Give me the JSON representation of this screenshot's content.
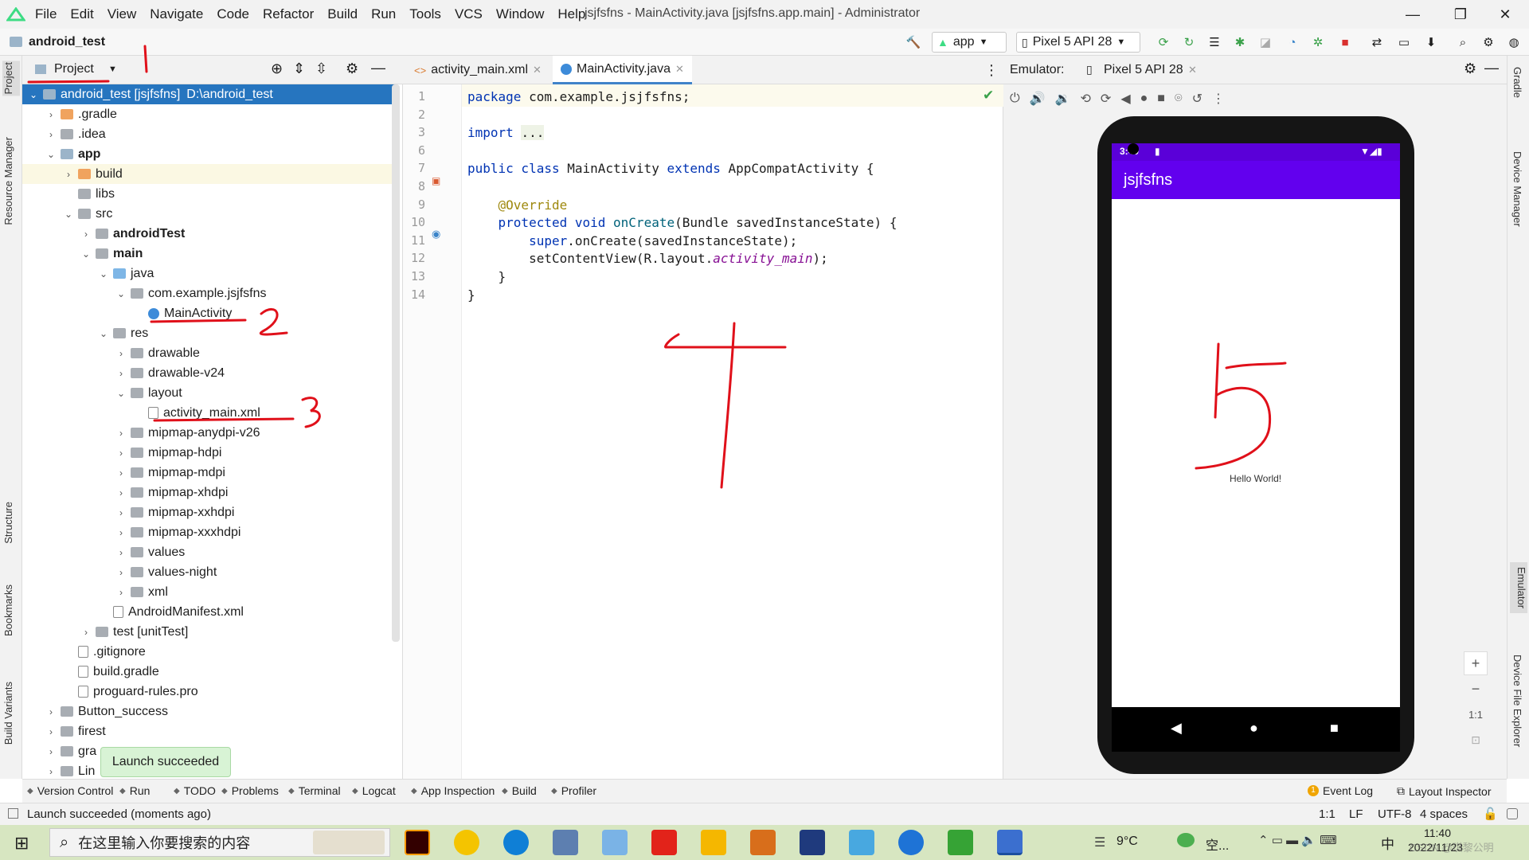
{
  "app": {
    "menus": [
      "File",
      "Edit",
      "View",
      "Navigate",
      "Code",
      "Refactor",
      "Build",
      "Run",
      "Tools",
      "VCS",
      "Window",
      "Help"
    ],
    "window_title": "jsjfsfns - MainActivity.java [jsjfsfns.app.main] - Administrator",
    "project_name": "android_test",
    "colors": {
      "accent": "#2675bf",
      "android_green": "#3ddc84",
      "app_bar": "#6200ee",
      "annotation_red": "#e0101a"
    }
  },
  "toolbar": {
    "run_config": "app",
    "device": "Pixel 5 API 28"
  },
  "left_stripe": [
    "Project",
    "Resource Manager",
    "Structure",
    "Bookmarks",
    "Build Variants"
  ],
  "right_stripe": [
    "Gradle",
    "Device Manager",
    "Emulator",
    "Device File Explorer"
  ],
  "project_panel": {
    "view_mode": "Project",
    "tree": [
      {
        "label": "android_test [jsjfsfns]",
        "suffix": "D:\\android_test",
        "depth": 0,
        "icon": "fold-m",
        "open": true,
        "selected": true
      },
      {
        "label": ".gradle",
        "depth": 1,
        "icon": "fold-o",
        "open": false
      },
      {
        "label": ".idea",
        "depth": 1,
        "icon": "fold",
        "open": false
      },
      {
        "label": "app",
        "depth": 1,
        "icon": "fold-m",
        "open": true,
        "bold": true
      },
      {
        "label": "build",
        "depth": 2,
        "icon": "fold-o",
        "open": false,
        "highlight": true
      },
      {
        "label": "libs",
        "depth": 2,
        "icon": "fold",
        "leaf": true
      },
      {
        "label": "src",
        "depth": 2,
        "icon": "fold",
        "open": true
      },
      {
        "label": "androidTest",
        "depth": 3,
        "icon": "fold",
        "open": false,
        "bold": true
      },
      {
        "label": "main",
        "depth": 3,
        "icon": "fold",
        "open": true,
        "bold": true
      },
      {
        "label": "java",
        "depth": 4,
        "icon": "fold-b",
        "open": true
      },
      {
        "label": "com.example.jsjfsfns",
        "depth": 5,
        "icon": "fold",
        "open": true
      },
      {
        "label": "MainActivity",
        "depth": 6,
        "icon": "cls",
        "leaf": true
      },
      {
        "label": "res",
        "depth": 4,
        "icon": "fold",
        "open": true
      },
      {
        "label": "drawable",
        "depth": 5,
        "icon": "fold",
        "open": false
      },
      {
        "label": "drawable-v24",
        "depth": 5,
        "icon": "fold",
        "open": false
      },
      {
        "label": "layout",
        "depth": 5,
        "icon": "fold",
        "open": true
      },
      {
        "label": "activity_main.xml",
        "depth": 6,
        "icon": "file",
        "leaf": true
      },
      {
        "label": "mipmap-anydpi-v26",
        "depth": 5,
        "icon": "fold",
        "open": false
      },
      {
        "label": "mipmap-hdpi",
        "depth": 5,
        "icon": "fold",
        "open": false
      },
      {
        "label": "mipmap-mdpi",
        "depth": 5,
        "icon": "fold",
        "open": false
      },
      {
        "label": "mipmap-xhdpi",
        "depth": 5,
        "icon": "fold",
        "open": false
      },
      {
        "label": "mipmap-xxhdpi",
        "depth": 5,
        "icon": "fold",
        "open": false
      },
      {
        "label": "mipmap-xxxhdpi",
        "depth": 5,
        "icon": "fold",
        "open": false
      },
      {
        "label": "values",
        "depth": 5,
        "icon": "fold",
        "open": false
      },
      {
        "label": "values-night",
        "depth": 5,
        "icon": "fold",
        "open": false
      },
      {
        "label": "xml",
        "depth": 5,
        "icon": "fold",
        "open": false
      },
      {
        "label": "AndroidManifest.xml",
        "depth": 4,
        "icon": "file",
        "leaf": true
      },
      {
        "label": "test [unitTest]",
        "depth": 3,
        "icon": "fold",
        "open": false
      },
      {
        "label": ".gitignore",
        "depth": 2,
        "icon": "file",
        "leaf": true
      },
      {
        "label": "build.gradle",
        "depth": 2,
        "icon": "file",
        "leaf": true
      },
      {
        "label": "proguard-rules.pro",
        "depth": 2,
        "icon": "file",
        "leaf": true
      },
      {
        "label": "Button_success",
        "depth": 1,
        "icon": "fold",
        "open": false
      },
      {
        "label": "firest",
        "depth": 1,
        "icon": "fold",
        "open": false
      },
      {
        "label": "gra",
        "depth": 1,
        "icon": "fold",
        "open": false
      },
      {
        "label": "Lin",
        "depth": 1,
        "icon": "fold",
        "open": false
      }
    ]
  },
  "editor": {
    "tabs": [
      {
        "label": "activity_main.xml",
        "active": false
      },
      {
        "label": "MainActivity.java",
        "active": true
      }
    ],
    "lines": [
      {
        "n": "1",
        "html": "<span class='kw'>package</span> com.example.jsjfsfns;"
      },
      {
        "n": "2",
        "html": ""
      },
      {
        "n": "3",
        "html": "<span class='kw'>import</span> <span style='background:#eef3e6'>...</span>"
      },
      {
        "n": "6",
        "html": ""
      },
      {
        "n": "7",
        "html": "<span class='kw'>public class</span> MainActivity <span class='kw'>extends</span> AppCompatActivity {"
      },
      {
        "n": "8",
        "html": ""
      },
      {
        "n": "9",
        "html": "    <span class='ann'>@Override</span>"
      },
      {
        "n": "10",
        "html": "    <span class='kw'>protected void</span> <span class='fn'>onCreate</span>(Bundle savedInstanceState) {"
      },
      {
        "n": "11",
        "html": "        <span class='kw'>super</span>.onCreate(savedInstanceState);"
      },
      {
        "n": "12",
        "html": "        setContentView(R.layout.<span class='it'>activity_main</span>);"
      },
      {
        "n": "13",
        "html": "    }"
      },
      {
        "n": "14",
        "html": "}"
      }
    ]
  },
  "emulator": {
    "label": "Emulator:",
    "tab": "Pixel 5 API 28",
    "clock": "3:40",
    "app_title": "jsjfsfns",
    "screen_text": "Hello World!",
    "zoom_labels": [
      "+",
      "−",
      "1:1"
    ]
  },
  "bottom_tools": [
    {
      "label": "Version Control",
      "icon": "branch-icon"
    },
    {
      "label": "Run",
      "icon": "run-icon"
    },
    {
      "label": "TODO",
      "icon": "list-icon"
    },
    {
      "label": "Problems",
      "icon": "info-icon"
    },
    {
      "label": "Terminal",
      "icon": "terminal-icon"
    },
    {
      "label": "Logcat",
      "icon": "logcat-icon"
    },
    {
      "label": "App Inspection",
      "icon": "inspect-icon"
    },
    {
      "label": "Build",
      "icon": "hammer-icon"
    },
    {
      "label": "Profiler",
      "icon": "gauge-icon"
    }
  ],
  "bottom_right_tools": [
    {
      "label": "Event Log",
      "badge": "1"
    },
    {
      "label": "Layout Inspector"
    }
  ],
  "status": {
    "message": "Launch succeeded (moments ago)",
    "position": "1:1",
    "line_sep": "LF",
    "encoding": "UTF-8",
    "indent": "4 spaces"
  },
  "toast": "Launch succeeded",
  "taskbar": {
    "search_placeholder": "在这里输入你要搜索的内容",
    "weather_temp": "9°C",
    "weather_text": "空...",
    "ime": "中",
    "time": "11:40",
    "date": "2022/11/23",
    "watermark": "CSDN @琪黎公明"
  },
  "annotations": [
    "1",
    "2",
    "3",
    "4",
    "5"
  ]
}
